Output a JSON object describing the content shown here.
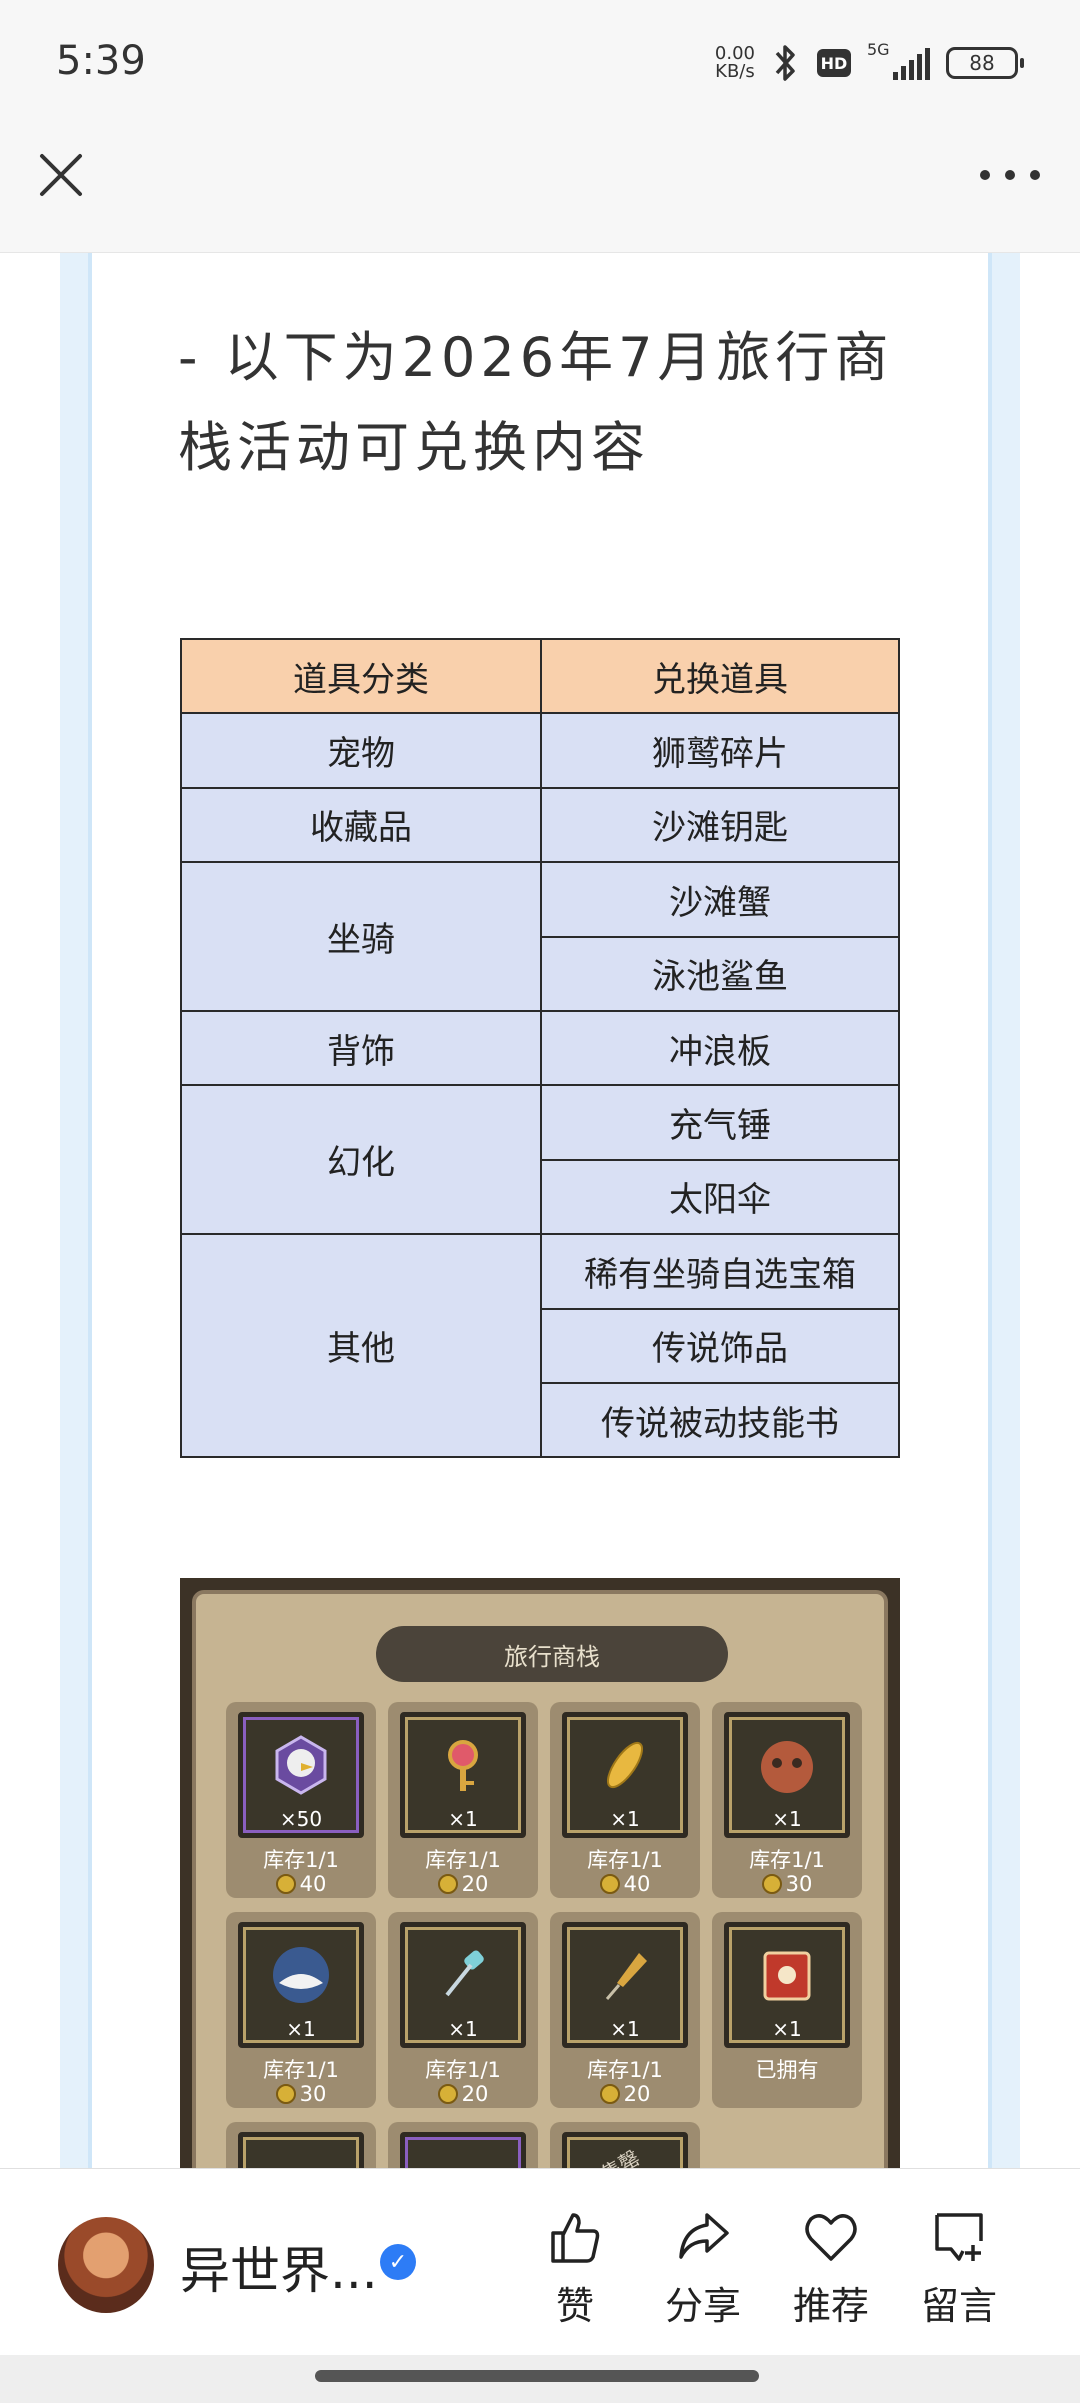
{
  "status_bar": {
    "time": "5:39",
    "net_speed_value": "0.00",
    "net_speed_unit": "KB/s",
    "network": "5G",
    "battery": "88",
    "icons": [
      "bluetooth-icon",
      "hd-icon",
      "signal-icon",
      "battery-icon"
    ]
  },
  "nav": {
    "close_icon": "close-icon",
    "more_icon": "more-icon"
  },
  "article": {
    "intro": "- 以下为2026年7月旅行商栈活动可兑换内容",
    "table": {
      "headers": [
        "道具分类",
        "兑换道具"
      ],
      "rows": [
        {
          "category": "宠物",
          "items": [
            "狮鹫碎片"
          ]
        },
        {
          "category": "收藏品",
          "items": [
            "沙滩钥匙"
          ]
        },
        {
          "category": "坐骑",
          "items": [
            "沙滩蟹",
            "泳池鲨鱼"
          ]
        },
        {
          "category": "背饰",
          "items": [
            "冲浪板"
          ]
        },
        {
          "category": "幻化",
          "items": [
            "充气锤",
            "太阳伞"
          ]
        },
        {
          "category": "其他",
          "items": [
            "稀有坐骑自选宝箱",
            "传说饰品",
            "传说被动技能书"
          ]
        }
      ]
    },
    "game_screenshot": {
      "title": "旅行商栈",
      "slots": [
        {
          "qty": "×50",
          "stock": "库存1/1",
          "price": "40",
          "icon": "griffin-icon",
          "frame": "purple"
        },
        {
          "qty": "×1",
          "stock": "库存1/1",
          "price": "20",
          "icon": "key-icon",
          "frame": "gold"
        },
        {
          "qty": "×1",
          "stock": "库存1/1",
          "price": "40",
          "icon": "surfboard-icon",
          "frame": "gold"
        },
        {
          "qty": "×1",
          "stock": "库存1/1",
          "price": "30",
          "icon": "crab-icon",
          "frame": "gold"
        },
        {
          "qty": "×1",
          "stock": "库存1/1",
          "price": "30",
          "icon": "shark-icon",
          "frame": "gold"
        },
        {
          "qty": "×1",
          "stock": "库存1/1",
          "price": "20",
          "icon": "hammer-icon",
          "frame": "gold"
        },
        {
          "qty": "×1",
          "stock": "库存1/1",
          "price": "20",
          "icon": "umbrella-icon",
          "frame": "gold"
        },
        {
          "qty": "×1",
          "stock": "已拥有",
          "price": "",
          "icon": "skill-book-icon",
          "frame": "gold"
        }
      ],
      "partial_row_stamp": "已售罄"
    }
  },
  "bottom": {
    "author": "异世界...",
    "actions": [
      {
        "label": "赞",
        "icon": "thumbs-up-icon"
      },
      {
        "label": "分享",
        "icon": "share-icon"
      },
      {
        "label": "推荐",
        "icon": "heart-icon"
      },
      {
        "label": "留言",
        "icon": "comment-icon"
      }
    ]
  }
}
